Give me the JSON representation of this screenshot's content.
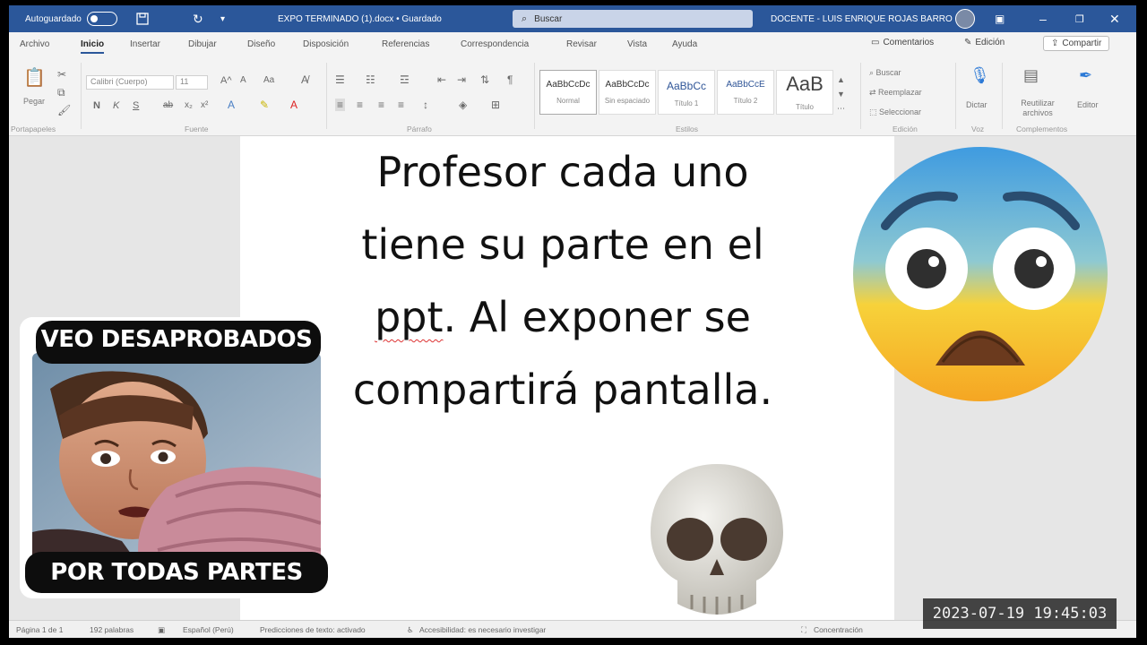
{
  "titlebar": {
    "autosave_label": "Autoguardado",
    "document_title": "EXPO TERMINADO (1).docx • Guardado",
    "search_placeholder": "Buscar",
    "user_name": "DOCENTE - LUIS ENRIQUE ROJAS BARRO"
  },
  "tabs": [
    "Archivo",
    "Inicio",
    "Insertar",
    "Dibujar",
    "Diseño",
    "Disposición",
    "Referencias",
    "Correspondencia",
    "Revisar",
    "Vista",
    "Ayuda"
  ],
  "active_tab": "Inicio",
  "tab_actions": {
    "comments": "Comentarios",
    "editing": "Edición",
    "share": "Compartir"
  },
  "ribbon": {
    "paste": "Pegar",
    "font_name": "Calibri (Cuerpo)",
    "font_size": "11",
    "groups": {
      "clipboard": "Portapapeles",
      "font": "Fuente",
      "paragraph": "Párrafo",
      "styles": "Estilos",
      "editing": "Edición",
      "voice": "Voz",
      "complements": "Complementos"
    },
    "styles": [
      {
        "sample": "AaBbCcDc",
        "name": "Normal"
      },
      {
        "sample": "AaBbCcDc",
        "name": "Sin espaciado"
      },
      {
        "sample": "AaBbCc",
        "name": "Título 1"
      },
      {
        "sample": "AaBbCcE",
        "name": "Título 2"
      },
      {
        "sample": "AaB",
        "name": "Título"
      }
    ],
    "editing_items": {
      "find": "Buscar",
      "replace": "Reemplazar",
      "select": "Seleccionar"
    },
    "dictate": "Dictar",
    "editor": "Editor",
    "reuse_files": "Reutilizar archivos"
  },
  "document": {
    "line1": "Profesor cada uno",
    "line2": "tiene su parte en el",
    "line3_word": "ppt",
    "line3_rest": ". Al exponer se",
    "line4": "compartirá pantalla."
  },
  "statusbar": {
    "page": "Página 1 de 1",
    "words": "192 palabras",
    "language": "Español (Perú)",
    "predictions": "Predicciones de texto: activado",
    "accessibility": "Accesibilidad: es necesario investigar",
    "focus": "Concentración"
  },
  "meme": {
    "caption_top": "VEO DESAPROBADOS",
    "caption_bottom": "POR TODAS PARTES"
  },
  "overlay": {
    "timestamp": "2023-07-19  19:45:03"
  },
  "colors": {
    "word_blue": "#2b579a",
    "emoji_yellow": "#f7c02f",
    "emoji_blue": "#4fa6e0"
  },
  "icons": [
    "save-icon",
    "redo-icon",
    "search-icon",
    "minimize-icon",
    "maximize-icon",
    "close-icon",
    "fearful-face-emoji",
    "skull-emoji",
    "microphone-icon",
    "editor-pen-icon"
  ]
}
